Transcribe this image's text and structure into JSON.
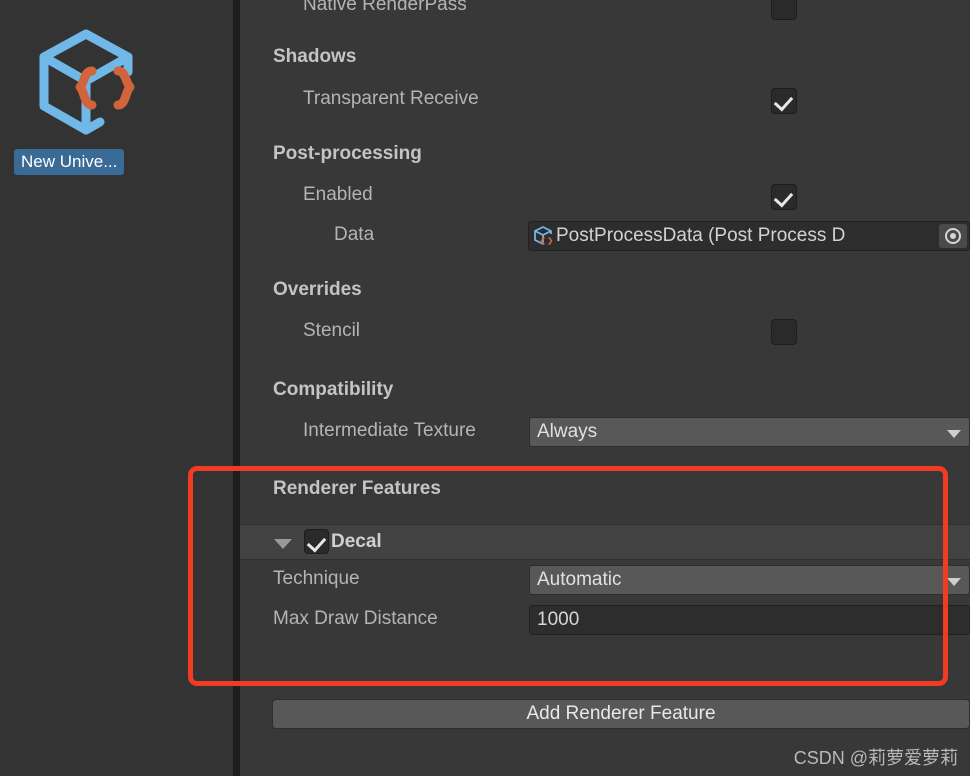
{
  "asset_preview": {
    "icon_name": "scriptable-object-cube-braces-icon",
    "label": "New Unive..."
  },
  "inspector": {
    "rows": [
      {
        "label": "Native RenderPass",
        "control": "checkbox",
        "checked": false
      },
      {
        "label": "Transparent Receive",
        "control": "checkbox",
        "checked": true
      },
      {
        "label": "Enabled",
        "control": "checkbox",
        "checked": true
      },
      {
        "label": "Stencil",
        "control": "checkbox",
        "checked": false
      }
    ],
    "native_render_pass": {
      "label": "Native RenderPass",
      "checked": false
    },
    "shadows": {
      "title": "Shadows",
      "transparent_receive": {
        "label": "Transparent Receive",
        "checked": true
      }
    },
    "post_processing": {
      "title": "Post-processing",
      "enabled": {
        "label": "Enabled",
        "checked": true
      },
      "data": {
        "label": "Data",
        "value": "PostProcessData (Post Process D",
        "icon": "scriptable-object-cube-braces-icon",
        "picker": "object-picker-icon"
      }
    },
    "overrides": {
      "title": "Overrides",
      "stencil": {
        "label": "Stencil",
        "checked": false
      }
    },
    "compatibility": {
      "title": "Compatibility",
      "intermediate_texture": {
        "label": "Intermediate Texture",
        "value": "Always"
      }
    },
    "renderer_features": {
      "title": "Renderer Features",
      "items": [
        {
          "name": "Decal",
          "enabled": true,
          "expanded": true,
          "properties": [
            {
              "label": "Technique",
              "control": "dropdown",
              "value": "Automatic"
            },
            {
              "label": "Max Draw Distance",
              "control": "text",
              "value": "1000"
            }
          ]
        }
      ],
      "add_button_label": "Add Renderer Feature"
    }
  },
  "watermark": "CSDN @莉萝爱萝莉",
  "colors": {
    "background": "#383838",
    "panel": "#333333",
    "divider": "#1e1e1e",
    "label_text": "#b4b4b4",
    "title_text": "#c4c4c4",
    "field_bg": "#2d2d2d",
    "dropdown_bg": "#585858",
    "row_highlight": "#424242",
    "selection_blue": "#3a6a96",
    "annotation_red": "#f03c23",
    "icon_blue": "#6fb8e8",
    "icon_orange": "#d2643c"
  }
}
